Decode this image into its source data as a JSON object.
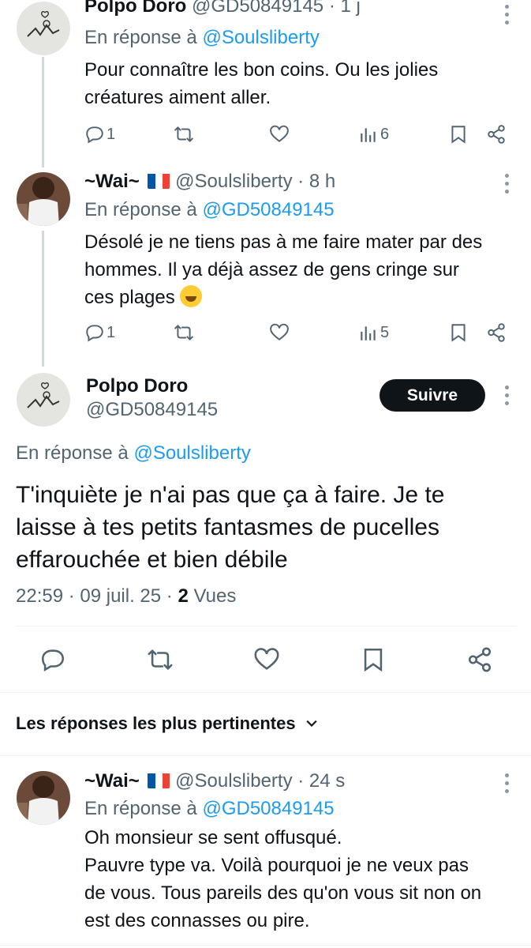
{
  "tweets": [
    {
      "name": "Polpo Doro",
      "handle": "@GD50849145",
      "time": "· 1 j",
      "reply_prefix": "En réponse à",
      "reply_to": "@Soulsliberty",
      "lines": [
        "Pour connaître les bon coins. Ou les jolies",
        "créatures aiment aller."
      ],
      "replies": "1",
      "views": "6"
    },
    {
      "name": "~Wai~",
      "handle": "@Soulsliberty",
      "time": "· 8 h",
      "reply_prefix": "En réponse à",
      "reply_to": "@GD50849145",
      "lines": [
        "Désolé je ne tiens pas à me faire mater par des",
        "hommes. Il ya déjà assez de gens cringe sur",
        "ces plages"
      ],
      "replies": "1",
      "views": "5"
    }
  ],
  "main": {
    "name": "Polpo Doro",
    "handle": "@GD50849145",
    "follow_label": "Suivre",
    "reply_prefix": "En réponse à",
    "reply_to": "@Soulsliberty",
    "lines": [
      "T'inquiète je n'ai pas que ça à faire. Je te",
      "laisse à tes petits fantasmes de pucelles",
      "effarouchée et bien débile"
    ],
    "time": "22:59 · 09 juil. 25 ·",
    "views_count": "2",
    "views_label": "Vues"
  },
  "sort_label": "Les réponses les plus pertinentes",
  "reply": {
    "name": "~Wai~",
    "handle": "@Soulsliberty",
    "time": "· 24 s",
    "reply_prefix": "En réponse à",
    "reply_to": "@GD50849145",
    "lines": [
      "Oh monsieur se sent offusqué.",
      "Pauvre type va. Voilà pourquoi je ne veux pas",
      "de vous. Tous pareils des qu'on vous sit non on",
      "est des connasses ou pire."
    ]
  },
  "colors": {
    "link": "#1d9bf0",
    "muted": "#536471",
    "text": "#0f1419",
    "button": "#0f1419"
  },
  "icons": [
    "reply-icon",
    "retweet-icon",
    "like-icon",
    "views-icon",
    "bookmark-icon",
    "share-icon",
    "more-icon",
    "chevron-down-icon",
    "flag-fr-icon",
    "sweat-smile-emoji"
  ]
}
